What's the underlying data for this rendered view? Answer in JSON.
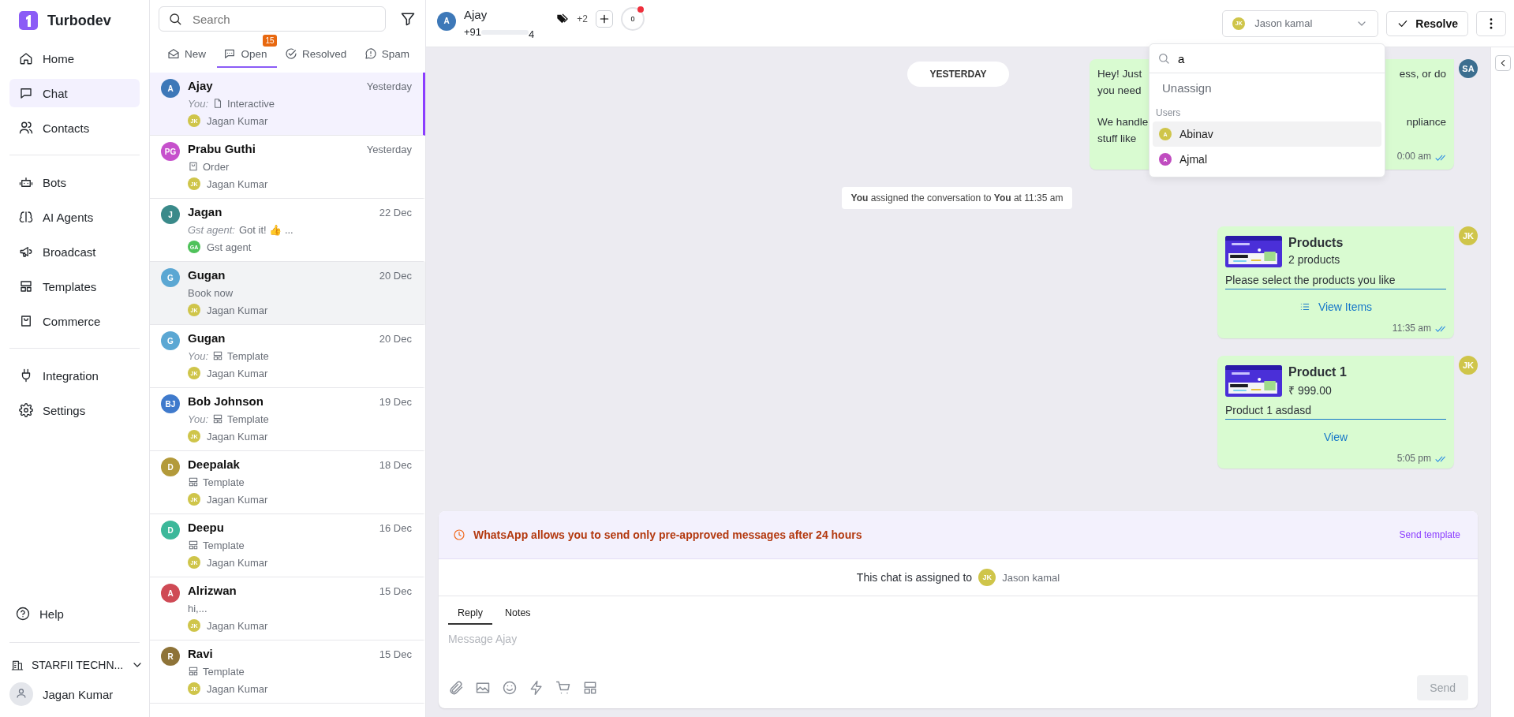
{
  "brand": {
    "name": "Turbodev"
  },
  "nav_groups": [
    {
      "items": [
        {
          "label": "Home",
          "selected": false
        },
        {
          "label": "Chat",
          "selected": true
        },
        {
          "label": "Contacts",
          "selected": false
        }
      ]
    },
    {
      "items": [
        {
          "label": "Bots",
          "selected": false
        },
        {
          "label": "AI Agents",
          "selected": false
        },
        {
          "label": "Broadcast",
          "selected": false
        },
        {
          "label": "Templates",
          "selected": false
        },
        {
          "label": "Commerce",
          "selected": false
        }
      ]
    },
    {
      "items": [
        {
          "label": "Integration",
          "selected": false
        },
        {
          "label": "Settings",
          "selected": false
        }
      ]
    }
  ],
  "help": "Help",
  "workspace": "STARFII TECHN...",
  "user": "Jagan Kumar",
  "list": {
    "search_placeholder": "Search",
    "tabs": [
      {
        "label": "New",
        "selected": false
      },
      {
        "label": "Open",
        "selected": true,
        "badge": "15"
      },
      {
        "label": "Resolved",
        "selected": false
      },
      {
        "label": "Spam",
        "selected": false
      }
    ]
  },
  "conversations": [
    {
      "initials": "A",
      "color": "#3d78b8",
      "name": "Ajay",
      "time": "Yesterday",
      "preview": {
        "prefix": "You:",
        "kind": "interactive",
        "text": "Interactive"
      },
      "agent": {
        "initials": "JK",
        "name": "Jagan Kumar",
        "color": "#cfc54a"
      },
      "selected": true,
      "highlighted": false
    },
    {
      "initials": "PG",
      "color": "#c651cc",
      "name": "Prabu Guthi",
      "time": "Yesterday",
      "preview": {
        "kind": "order",
        "text": "Order"
      },
      "agent": {
        "initials": "JK",
        "name": "Jagan Kumar",
        "color": "#cfc54a"
      },
      "selected": false,
      "highlighted": false
    },
    {
      "initials": "J",
      "color": "#3a8a8a",
      "name": "Jagan",
      "time": "22 Dec",
      "preview": {
        "prefix": "Gst agent:",
        "kind": "text",
        "text": "Got it! 👍 ..."
      },
      "agent": {
        "initials": "GA",
        "name": "Gst agent",
        "color": "#4fc25a"
      },
      "selected": false,
      "highlighted": false
    },
    {
      "initials": "G",
      "color": "#5ba7d3",
      "name": "Gugan",
      "time": "20 Dec",
      "preview": {
        "kind": "text",
        "text": "Book now"
      },
      "agent": {
        "initials": "JK",
        "name": "Jagan Kumar",
        "color": "#cfc54a"
      },
      "selected": false,
      "highlighted": true
    },
    {
      "initials": "G",
      "color": "#5ba7d3",
      "name": "Gugan",
      "time": "20 Dec",
      "preview": {
        "prefix": "You:",
        "kind": "template",
        "text": "Template"
      },
      "agent": {
        "initials": "JK",
        "name": "Jagan Kumar",
        "color": "#cfc54a"
      },
      "selected": false,
      "highlighted": false
    },
    {
      "initials": "BJ",
      "color": "#3f7acc",
      "name": "Bob Johnson",
      "time": "19 Dec",
      "preview": {
        "prefix": "You:",
        "kind": "template",
        "text": "Template"
      },
      "agent": {
        "initials": "JK",
        "name": "Jagan Kumar",
        "color": "#cfc54a"
      },
      "selected": false,
      "highlighted": false
    },
    {
      "initials": "D",
      "color": "#b39a3a",
      "name": "Deepalak",
      "time": "18 Dec",
      "preview": {
        "kind": "template",
        "text": "Template"
      },
      "agent": {
        "initials": "JK",
        "name": "Jagan Kumar",
        "color": "#cfc54a"
      },
      "selected": false,
      "highlighted": false
    },
    {
      "initials": "D",
      "color": "#3cb89a",
      "name": "Deepu",
      "time": "16 Dec",
      "preview": {
        "kind": "template",
        "text": "Template"
      },
      "agent": {
        "initials": "JK",
        "name": "Jagan Kumar",
        "color": "#cfc54a"
      },
      "selected": false,
      "highlighted": false
    },
    {
      "initials": "A",
      "color": "#cf4a55",
      "name": "Alrizwan",
      "time": "15 Dec",
      "preview": {
        "kind": "text",
        "text": "hi,..."
      },
      "agent": {
        "initials": "JK",
        "name": "Jagan Kumar",
        "color": "#cfc54a"
      },
      "selected": false,
      "highlighted": false
    },
    {
      "initials": "R",
      "color": "#8e7338",
      "name": "Ravi",
      "time": "15 Dec",
      "preview": {
        "kind": "template",
        "text": "Template"
      },
      "agent": {
        "initials": "JK",
        "name": "Jagan Kumar",
        "color": "#cfc54a"
      },
      "selected": false,
      "highlighted": false
    }
  ],
  "chat_header": {
    "initials": "A",
    "color": "#3d78b8",
    "name": "Ajay",
    "phone_start": "+91",
    "phone_end": "4",
    "tag_count": "+2",
    "unread": "0"
  },
  "assignee": {
    "initials": "JK",
    "name": "Jason kamal"
  },
  "resolve": "Resolve",
  "dropdown": {
    "query": "a",
    "unassign": "Unassign",
    "section": "Users",
    "users": [
      {
        "initials": "A",
        "name": "Abinav",
        "color": "#cfc54a",
        "highlighted": true
      },
      {
        "initials": "A",
        "name": "Ajmal",
        "color": "#c04cc0",
        "highlighted": false
      }
    ]
  },
  "date_chip": "YESTERDAY",
  "messages": [
    {
      "kind": "text",
      "sender": {
        "initials": "SA",
        "color": "#3c6e8f"
      },
      "paragraphs": [
        [
          {
            "left": "Hey! Just",
            "right": "ess, or do"
          },
          {
            "left": "you need"
          }
        ],
        [
          {
            "left": "We handle",
            "right": "npliance"
          },
          {
            "left": "stuff like"
          }
        ]
      ],
      "time": "0:00 am",
      "read": true
    },
    {
      "kind": "system",
      "text": "**You** assigned the conversation to **You** at 11:35 am"
    },
    {
      "kind": "product_list",
      "sender": {
        "initials": "JK",
        "color": "#cfc54a"
      },
      "title": "Products",
      "subtitle": "2 products",
      "body": "Please select the products you like",
      "action": "View Items",
      "time": "11:35 am",
      "read": true
    },
    {
      "kind": "product",
      "sender": {
        "initials": "JK",
        "color": "#cfc54a"
      },
      "title": "Product 1",
      "subtitle": "₹ 999.00",
      "body": "Product 1 asdasd",
      "action": "View",
      "time": "5:05 pm",
      "read": true
    }
  ],
  "composer": {
    "notice": "WhatsApp allows you to send only pre-approved messages after 24 hours",
    "notice_action": "Send template",
    "assigned_label": "This chat is assigned to",
    "assigned_initials": "JK",
    "assigned_name": "Jason kamal",
    "tabs": [
      {
        "label": "Reply",
        "selected": true
      },
      {
        "label": "Notes",
        "selected": false
      }
    ],
    "placeholder": "Message Ajay",
    "send": "Send",
    "send_disabled": true
  }
}
